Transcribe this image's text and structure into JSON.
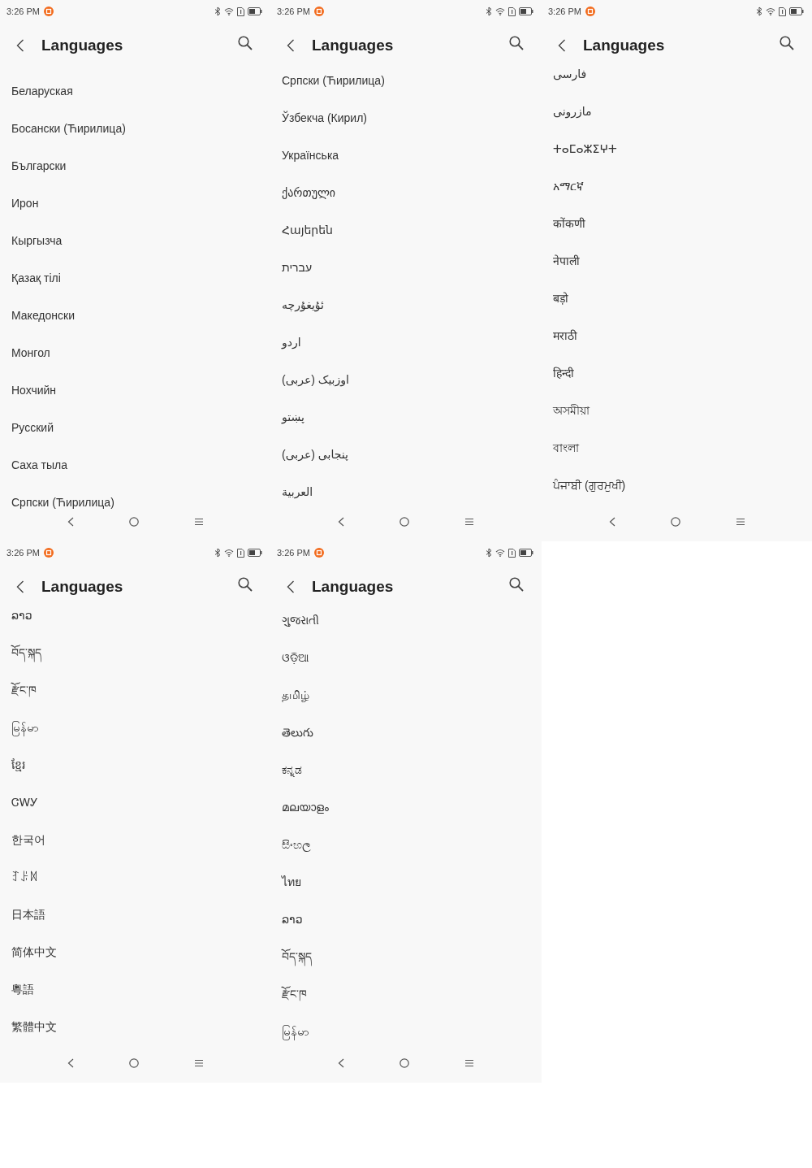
{
  "screens": [
    {
      "status_bar": {
        "time": "3:26 PM"
      },
      "title": "Languages",
      "languages": [
        "Беларуская",
        "Босански (Ћирилица)",
        "Български",
        "Ирон",
        "Кыргызча",
        "Қазақ тілі",
        "Македонски",
        "Монгол",
        "Нохчийн",
        "Русский",
        "Саха тыла",
        "Српски (Ћирилица)"
      ]
    },
    {
      "status_bar": {
        "time": "3:26 PM"
      },
      "title": "Languages",
      "languages": [
        "Српски (Ћирилица)",
        "Ўзбекча (Кирил)",
        "Українська",
        "ქართული",
        "Հայերեն",
        "עברית",
        "ئۇيغۇرچە",
        "اردو",
        "اوزبیک (عربی)",
        "پښتو",
        "پنجابی (عربی)",
        "العربية"
      ]
    },
    {
      "status_bar": {
        "time": "3:26 PM"
      },
      "title": "Languages",
      "languages": [
        "فارسی",
        "مازرونی",
        "ⵜⴰⵎⴰⵣⵉⵖⵜ",
        "አማርኛ",
        "कोंकणी",
        "नेपाली",
        "बड़ो",
        "मराठी",
        "हिन्दी",
        "অসমীয়া",
        "বাংলা",
        "ਪੰਜਾਬੀ (ਗੁਰਮੁਖੀ)"
      ]
    },
    {
      "status_bar": {
        "time": "3:26 PM"
      },
      "title": "Languages",
      "languages": [
        "ລາວ",
        "བོད་སྐད",
        "རྫོང་ཁ",
        "မြန်မာ",
        "ខ្មែរ",
        "ᏣᎳᎩ",
        "한국어",
        "ꆈꌠꉙ",
        "日本語",
        "简体中文",
        "粵語",
        "繁體中文"
      ]
    },
    {
      "status_bar": {
        "time": "3:26 PM"
      },
      "title": "Languages",
      "languages": [
        "ગુજરાતી",
        "ଓଡ଼ିଆ",
        "தமிழ்",
        "తెలుగు",
        "ಕನ್ನಡ",
        "മലയാളം",
        "සිංහල",
        "ไทย",
        "ລາວ",
        "བོད་སྐད",
        "རྫོང་ཁ",
        "မြန်မာ"
      ]
    }
  ]
}
